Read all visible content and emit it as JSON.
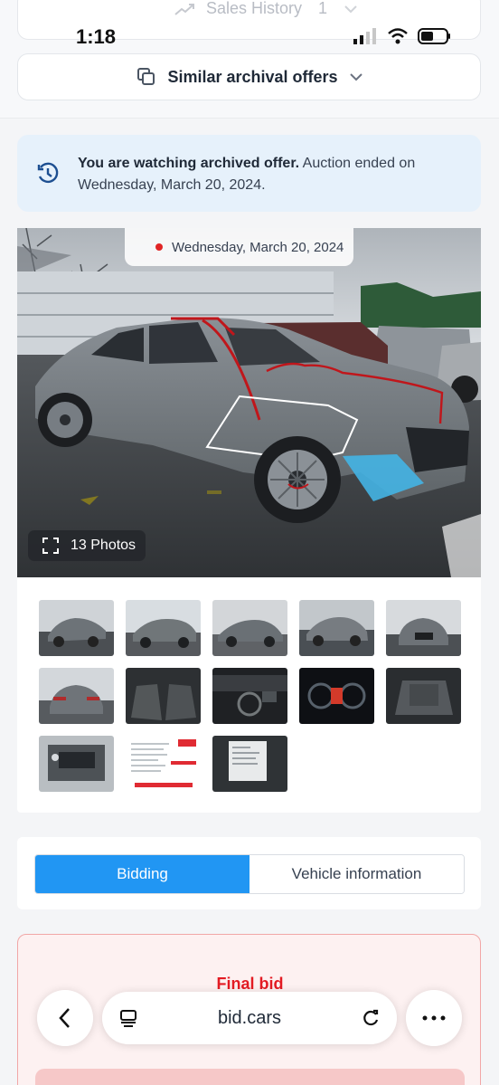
{
  "status": {
    "time": "1:18"
  },
  "top_cards": {
    "sales_history_label": "Sales History",
    "sales_history_count": "1",
    "similar_label": "Similar archival offers"
  },
  "archived_notice": {
    "strong": "You are watching archived offer.",
    "text": " Auction ended on Wednesday, March 20, 2024."
  },
  "gallery": {
    "date": "Wednesday, March 20, 2024",
    "photos_count": "13 Photos",
    "thumbnails": [
      "front-left exterior",
      "rear-left exterior",
      "left side exterior",
      "front-left exterior alt",
      "front exterior",
      "rear exterior",
      "front interior",
      "dashboard interior",
      "gauge cluster",
      "rear seats",
      "engine bay",
      "document sheet",
      "label sticker"
    ]
  },
  "tabs": {
    "active": "Bidding",
    "inactive": "Vehicle information"
  },
  "final_bid": {
    "label": "Final bid"
  },
  "browser": {
    "url": "bid.cars"
  },
  "colors": {
    "accent_blue": "#2196f3",
    "alert_red": "#e31b23",
    "banner_blue": "#e6f1fb"
  }
}
